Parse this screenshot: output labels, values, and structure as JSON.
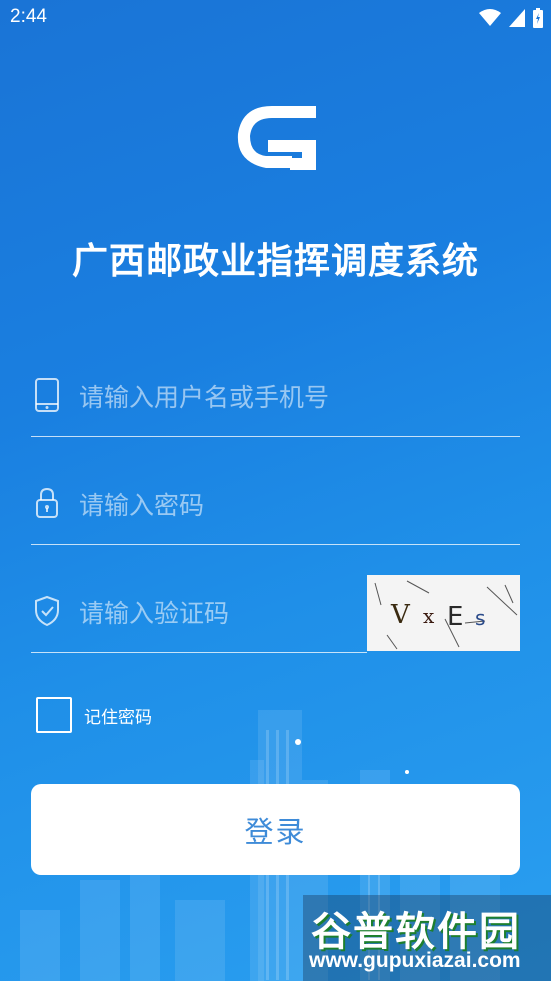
{
  "status_bar": {
    "time": "2:44",
    "icons": [
      "wifi-icon",
      "cellular-icon",
      "battery-icon"
    ]
  },
  "app": {
    "title": "广西邮政业指挥调度系统",
    "logo_icon": "gz-logo-icon"
  },
  "form": {
    "username": {
      "placeholder": "请输入用户名或手机号",
      "value": "",
      "icon": "phone-icon"
    },
    "password": {
      "placeholder": "请输入密码",
      "value": "",
      "icon": "lock-icon"
    },
    "captcha": {
      "placeholder": "请输入验证码",
      "value": "",
      "icon": "shield-check-icon",
      "image_text": "VxEs"
    },
    "remember": {
      "label": "记住密码",
      "checked": false
    },
    "login_label": "登录"
  },
  "watermark": {
    "title": "谷普软件园",
    "url": "www.gupuxiazai.com"
  },
  "colors": {
    "background": "#1a7fe0",
    "button_text": "#3e8bd8",
    "button_bg": "#ffffff"
  }
}
